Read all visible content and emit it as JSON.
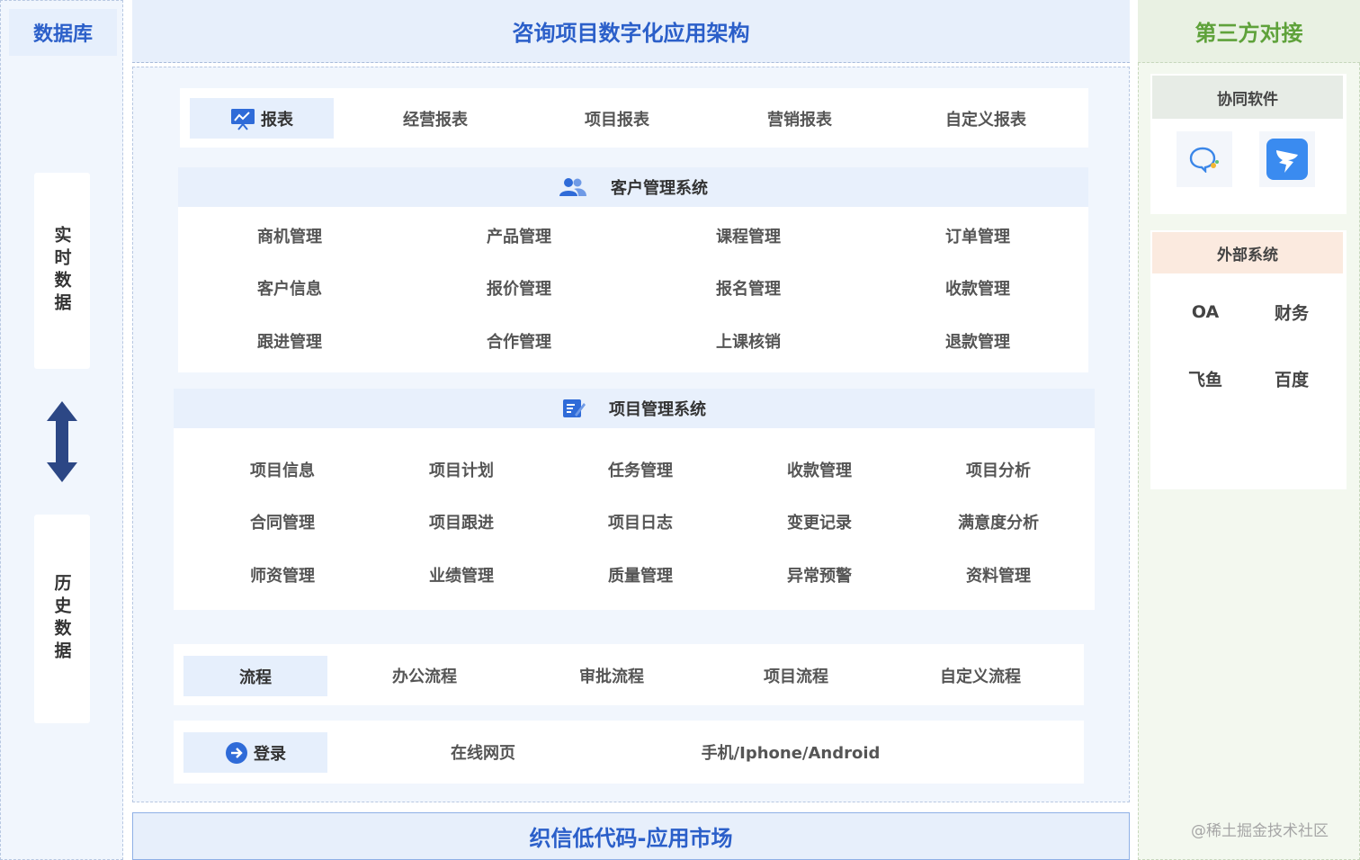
{
  "left": {
    "title": "数据库",
    "realtime_label": "实时数据",
    "history_label": "历史数据"
  },
  "header": {
    "title": "咨询项目数字化应用架构"
  },
  "reports": {
    "tag": "报表",
    "items": [
      "经营报表",
      "项目报表",
      "营销报表",
      "自定义报表"
    ]
  },
  "crm": {
    "title": "客户管理系统",
    "grid": [
      [
        "商机管理",
        "产品管理",
        "课程管理",
        "订单管理"
      ],
      [
        "客户信息",
        "报价管理",
        "报名管理",
        "收款管理"
      ],
      [
        "跟进管理",
        "合作管理",
        "上课核销",
        "退款管理"
      ]
    ]
  },
  "pms": {
    "title": "项目管理系统",
    "grid": [
      [
        "项目信息",
        "项目计划",
        "任务管理",
        "收款管理",
        "项目分析"
      ],
      [
        "合同管理",
        "项目跟进",
        "项目日志",
        "变更记录",
        "满意度分析"
      ],
      [
        "师资管理",
        "业绩管理",
        "质量管理",
        "异常预警",
        "资料管理"
      ]
    ]
  },
  "process": {
    "tag": "流程",
    "items": [
      "办公流程",
      "审批流程",
      "项目流程",
      "自定义流程"
    ]
  },
  "login": {
    "tag": "登录",
    "items": [
      "在线网页",
      "手机/Iphone/Android"
    ]
  },
  "footer": {
    "title": "织信低代码-应用市场"
  },
  "right": {
    "title": "第三方对接",
    "collab_title": "协同软件",
    "apps": [
      "chat-bubble-icon",
      "dingtalk-icon"
    ],
    "external_title": "外部系统",
    "external_items": [
      "OA",
      "财务",
      "飞鱼",
      "百度"
    ]
  },
  "watermark": "@稀土掘金技术社区",
  "colors": {
    "accent_blue": "#2b5fc9",
    "accent_green": "#5fa23b",
    "arrow_navy": "#2c4785"
  }
}
